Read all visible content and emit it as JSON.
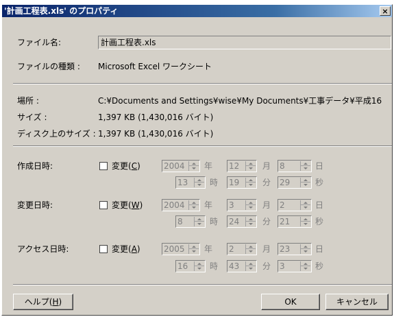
{
  "window": {
    "title": "'計画工程表.xls' のプロパティ",
    "close_glyph": "×"
  },
  "general": {
    "file_name_label": "ファイル名:",
    "file_name_value": "計画工程表.xls",
    "file_type_label": "ファイルの種類 :",
    "file_type_value": "Microsoft Excel ワークシート",
    "location_label": "場所 :",
    "location_value": "C:¥Documents and Settings¥wise¥My Documents¥工事データ¥平成16",
    "size_label": "サイズ :",
    "size_value": "1,397 KB (1,430,016 バイト)",
    "disk_size_label": "ディスク上のサイズ :",
    "disk_size_value": "1,397 KB (1,430,016 バイト)"
  },
  "units": {
    "year": "年",
    "month": "月",
    "day": "日",
    "hour": "時",
    "minute": "分",
    "second": "秒"
  },
  "created": {
    "label": "作成日時:",
    "checkbox_text": "変更(",
    "checkbox_key": "C",
    "checkbox_close": ")",
    "checked": false,
    "year": "2004",
    "month": "12",
    "day": "8",
    "hour": "13",
    "minute": "19",
    "second": "29"
  },
  "modified": {
    "label": "変更日時:",
    "checkbox_text": "変更(",
    "checkbox_key": "W",
    "checkbox_close": ")",
    "checked": false,
    "year": "2004",
    "month": "3",
    "day": "2",
    "hour": "8",
    "minute": "24",
    "second": "21"
  },
  "accessed": {
    "label": "アクセス日時:",
    "checkbox_text": "変更(",
    "checkbox_key": "A",
    "checkbox_close": ")",
    "checked": false,
    "year": "2005",
    "month": "2",
    "day": "23",
    "hour": "16",
    "minute": "43",
    "second": "3"
  },
  "buttons": {
    "help_text": "ヘルプ(",
    "help_key": "H",
    "help_close": ")",
    "ok": "OK",
    "cancel": "キャンセル"
  }
}
